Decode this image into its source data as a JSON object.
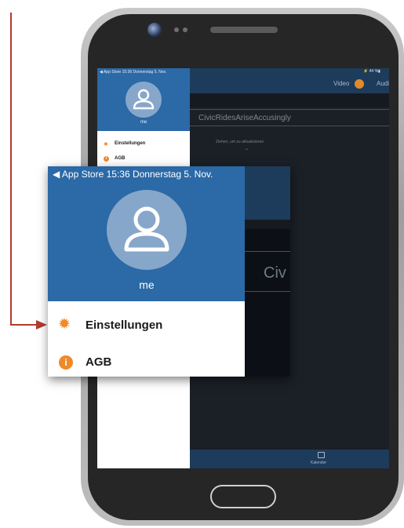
{
  "colors": {
    "phone_frame": "#a8a8a8",
    "menu_header_blue": "#2b69a7",
    "app_dark": "#1b1f26",
    "app_header": "#1d3c5c",
    "accent_orange": "#ef8a2a",
    "arrow_red": "#b33a2e"
  },
  "screen": {
    "status_right": "⚡ 44 %▮",
    "header": {
      "video_label": "Video",
      "audio_label": "Audi"
    },
    "search_text": "CivicRidesAriseAccusingly",
    "pull_hint": "Ziehen, um zu aktualisieren",
    "pull_chevron": "⌄",
    "bottom_tab": {
      "icon": "calendar-icon",
      "label": "Kalender"
    }
  },
  "side_menu": {
    "status": "◀ App Store  15:36  Donnerstag 5. Nov.",
    "user_name": "me",
    "avatar_icon": "user-icon",
    "items": [
      {
        "icon": "gear-icon",
        "glyph": "✹",
        "label": "Einstellungen"
      },
      {
        "icon": "info-icon",
        "glyph": "i",
        "label": "AGB"
      }
    ]
  },
  "zoom_callout": {
    "status": "◀ App Store   15:36   Donnerstag 5. Nov.",
    "user_name": "me",
    "behind_text": "Civ",
    "items": [
      {
        "icon": "gear-icon",
        "glyph": "✹",
        "label": "Einstellungen"
      },
      {
        "icon": "info-icon",
        "glyph": "i",
        "label": "AGB"
      }
    ]
  },
  "annotation": {
    "arrow": "pointer-arrow",
    "target": "Einstellungen"
  }
}
